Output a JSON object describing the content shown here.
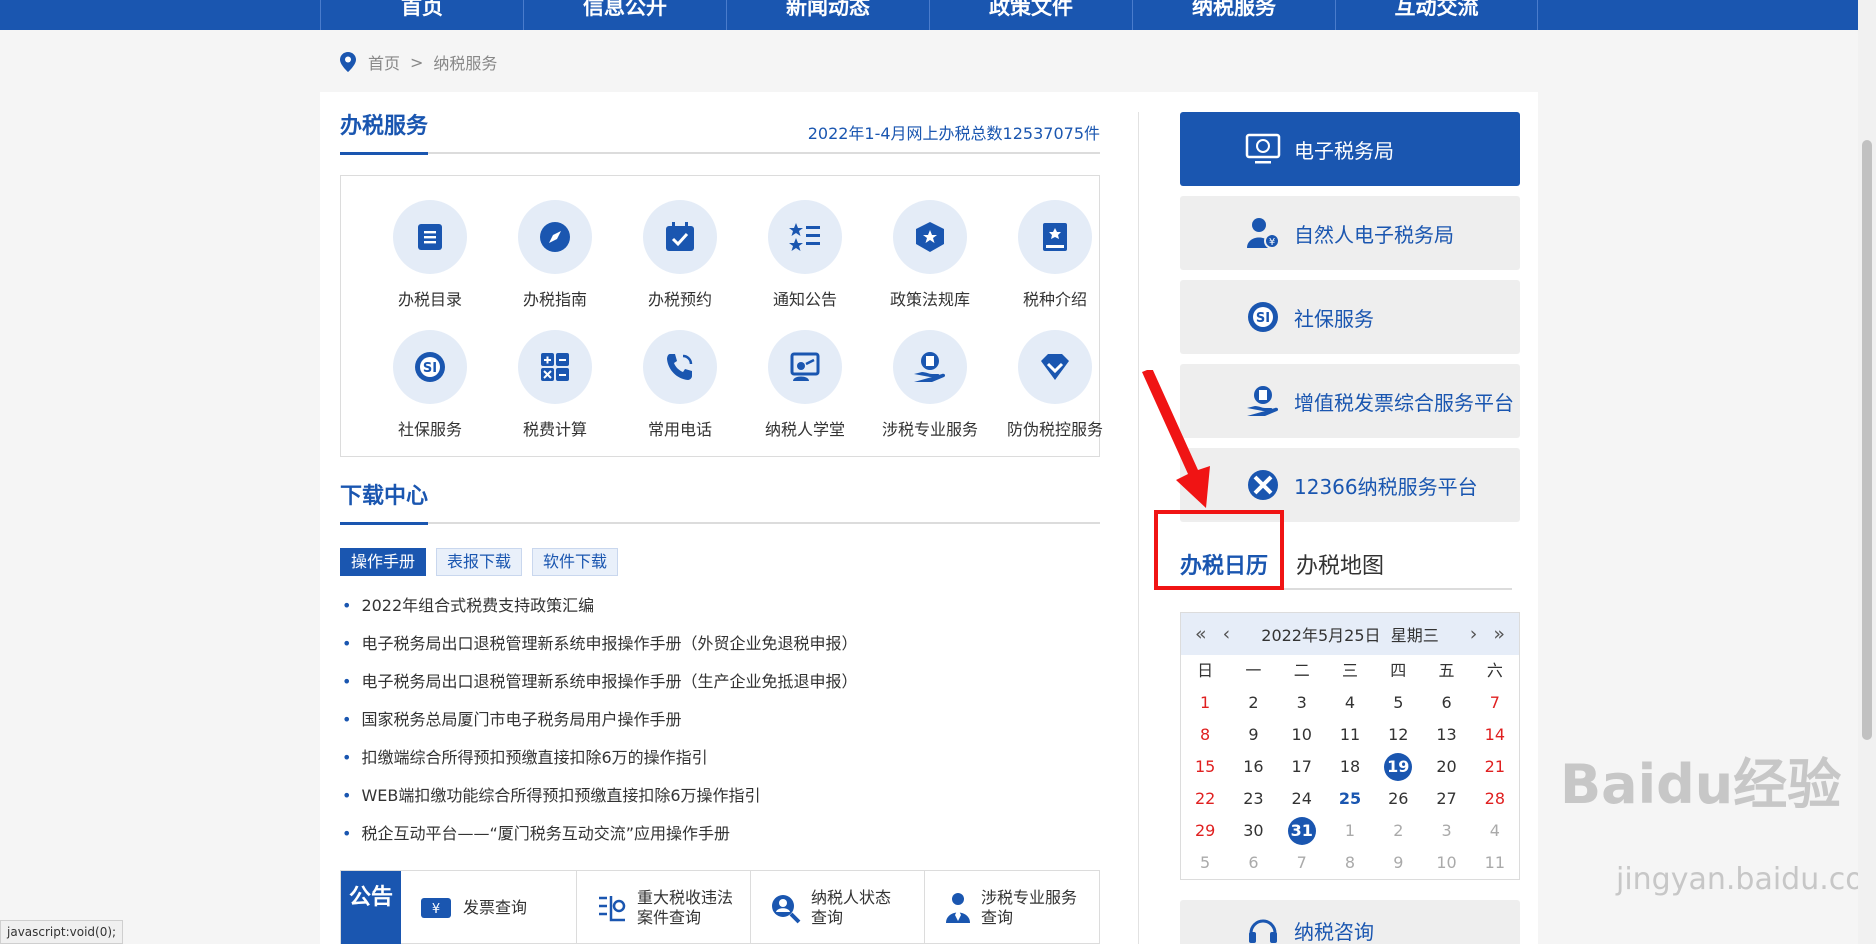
{
  "nav": [
    "首页",
    "信息公开",
    "新闻动态",
    "政策文件",
    "纳税服务",
    "互动交流"
  ],
  "breadcrumb": {
    "home": "首页",
    "sep": ">",
    "current": "纳税服务"
  },
  "tax_service": {
    "title": "办税服务",
    "stat": "2022年1-4月网上办税总数12537075件",
    "items": [
      "办税目录",
      "办税指南",
      "办税预约",
      "通知公告",
      "政策法规库",
      "税种介绍",
      "社保服务",
      "税费计算",
      "常用电话",
      "纳税人学堂",
      "涉税专业服务",
      "防伪税控服务"
    ]
  },
  "download": {
    "title": "下载中心",
    "tabs": [
      "操作手册",
      "表报下载",
      "软件下载"
    ],
    "items": [
      "2022年组合式税费支持政策汇编",
      "电子税务局出口退税管理新系统申报操作手册（外贸企业免退税申报）",
      "电子税务局出口退税管理新系统申报操作手册（生产企业免抵退申报）",
      "国家税务总局厦门市电子税务局用户操作手册",
      "扣缴端综合所得预扣预缴直接扣除6万的操作指引",
      "WEB端扣缴功能综合所得预扣预缴直接扣除6万操作指引",
      "税企互动平台——“厦门税务互动交流”应用操作手册"
    ]
  },
  "bottom": {
    "notice": "公告",
    "queries": [
      "发票查询",
      "重大税收违法案件查询",
      "纳税人状态查询",
      "涉税专业服务查询"
    ]
  },
  "right": {
    "buttons": [
      "电子税务局",
      "自然人电子税务局",
      "社保服务",
      "增值税发票综合服务平台",
      "12366纳税服务平台"
    ],
    "tabs": [
      "办税日历",
      "办税地图"
    ],
    "bottom_button": "纳税咨询"
  },
  "calendar": {
    "nav_prev_year": "«",
    "nav_prev": "‹",
    "nav_next": "›",
    "nav_next_year": "»",
    "date": "2022年5月25日",
    "weekday": "星期三",
    "weekdays": [
      "日",
      "一",
      "二",
      "三",
      "四",
      "五",
      "六"
    ]
  },
  "status_text": "javascript:void(0);",
  "watermark": "Baidu经验",
  "watermark_url": "jingyan.baidu.com",
  "colors": {
    "brand": "#1a56b0",
    "red": "#e02020",
    "annotation": "#f01414"
  }
}
